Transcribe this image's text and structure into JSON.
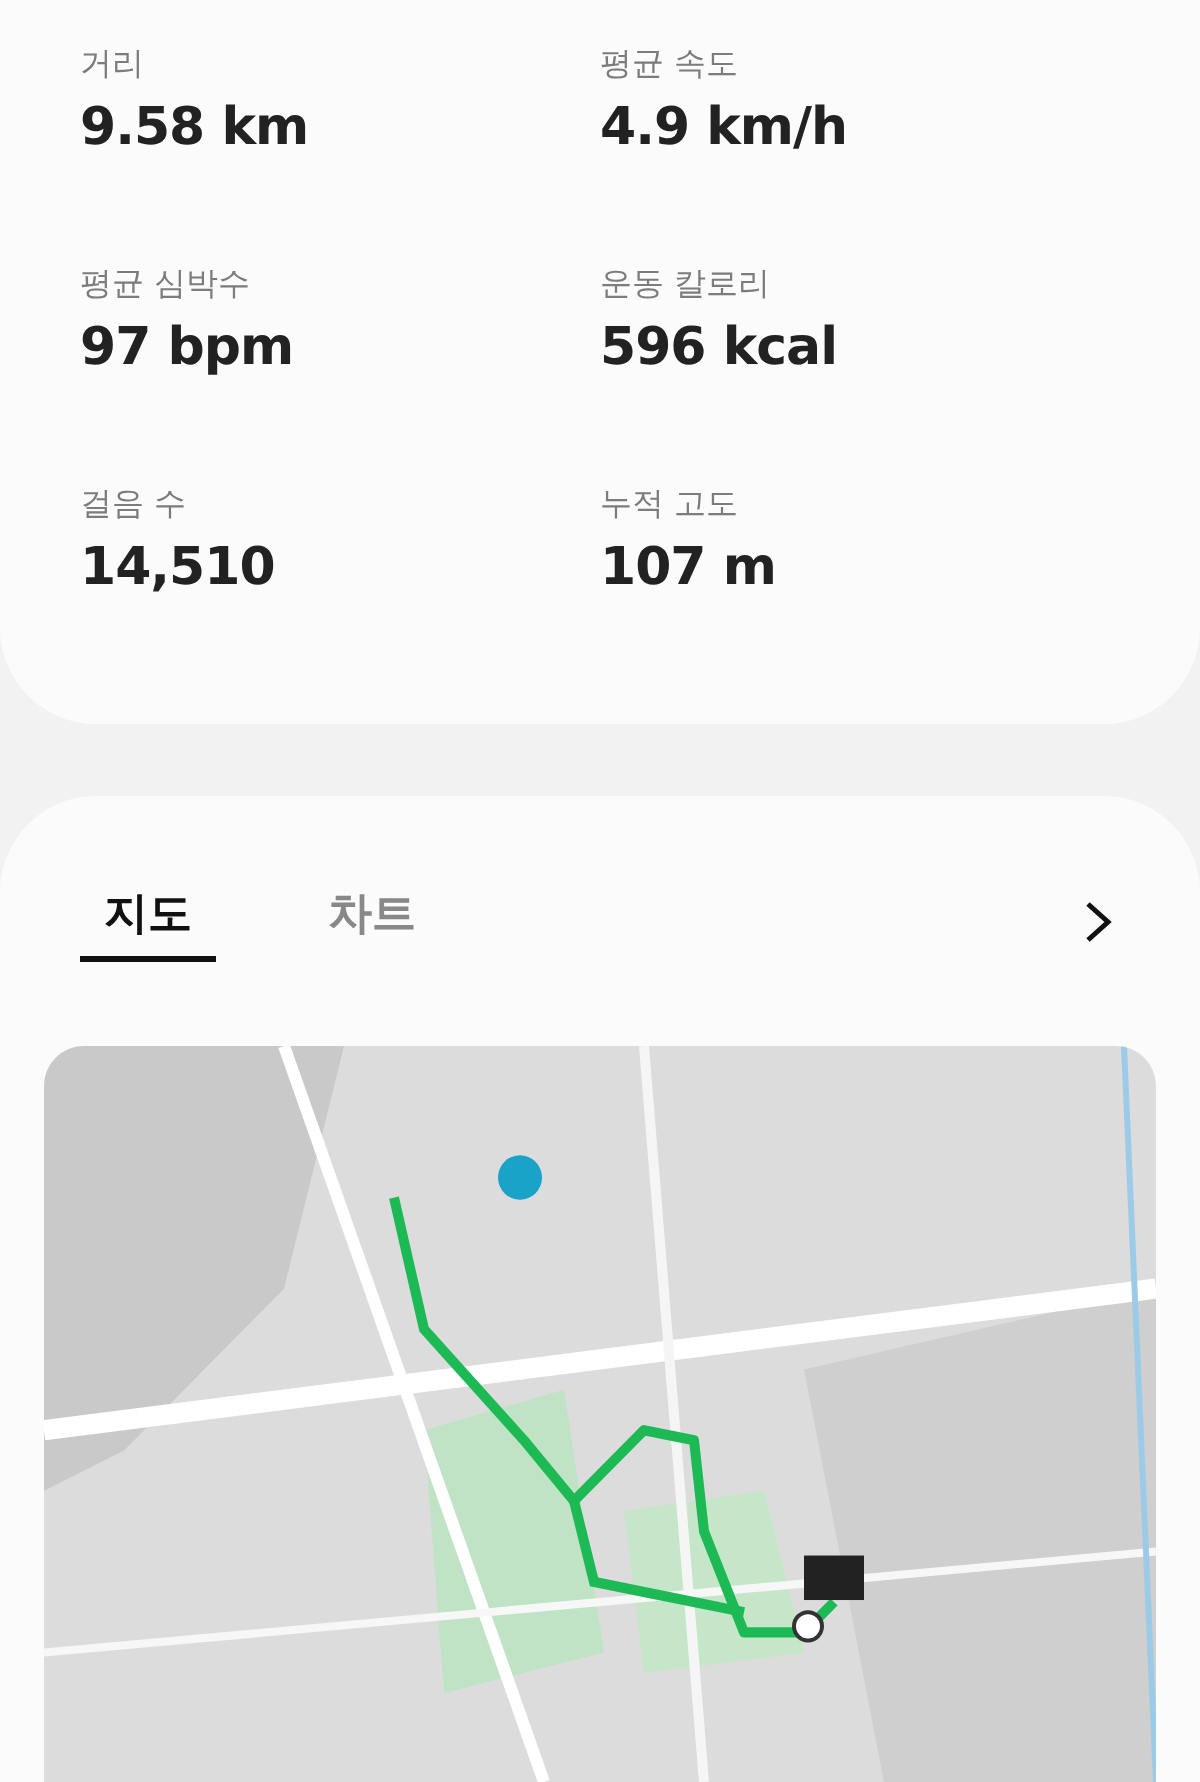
{
  "stats": [
    {
      "label": "거리",
      "value": "9.58 km"
    },
    {
      "label": "평균 속도",
      "value": "4.9 km/h"
    },
    {
      "label": "평균 심박수",
      "value": "97 bpm"
    },
    {
      "label": "운동 칼로리",
      "value": "596 kcal"
    },
    {
      "label": "걸음 수",
      "value": "14,510"
    },
    {
      "label": "누적 고도",
      "value": "107 m"
    }
  ],
  "tabs": [
    {
      "label": "지도",
      "selected": true
    },
    {
      "label": "차트",
      "selected": false
    }
  ]
}
